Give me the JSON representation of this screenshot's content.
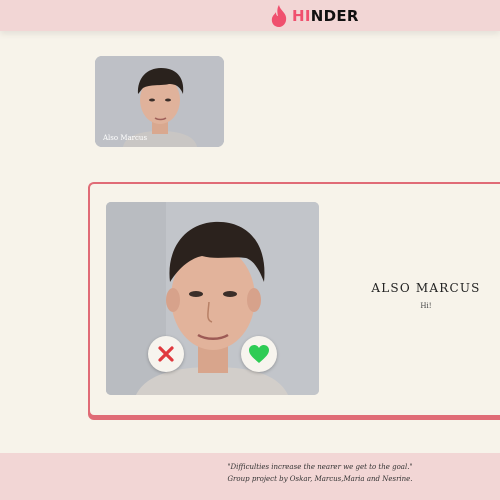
{
  "header": {
    "logo_hi": "HI",
    "logo_rest": "NDER",
    "logo_icon": "flame-icon",
    "brand_color": "#f0506e"
  },
  "queue": {
    "thumb_caption": "Also Marcus"
  },
  "profile": {
    "name": "ALSO MARCUS",
    "bio": "Hi!",
    "reject_icon": "close-icon",
    "like_icon": "heart-icon",
    "reject_color": "#e0383d",
    "like_color": "#2ecc55",
    "card_border_color": "#e06b76"
  },
  "footer": {
    "quote": "\"Difficulties increase the nearer we get to the goal.\"",
    "credits": "Group project by Oskar, Marcus,Maria and Nesrine."
  }
}
